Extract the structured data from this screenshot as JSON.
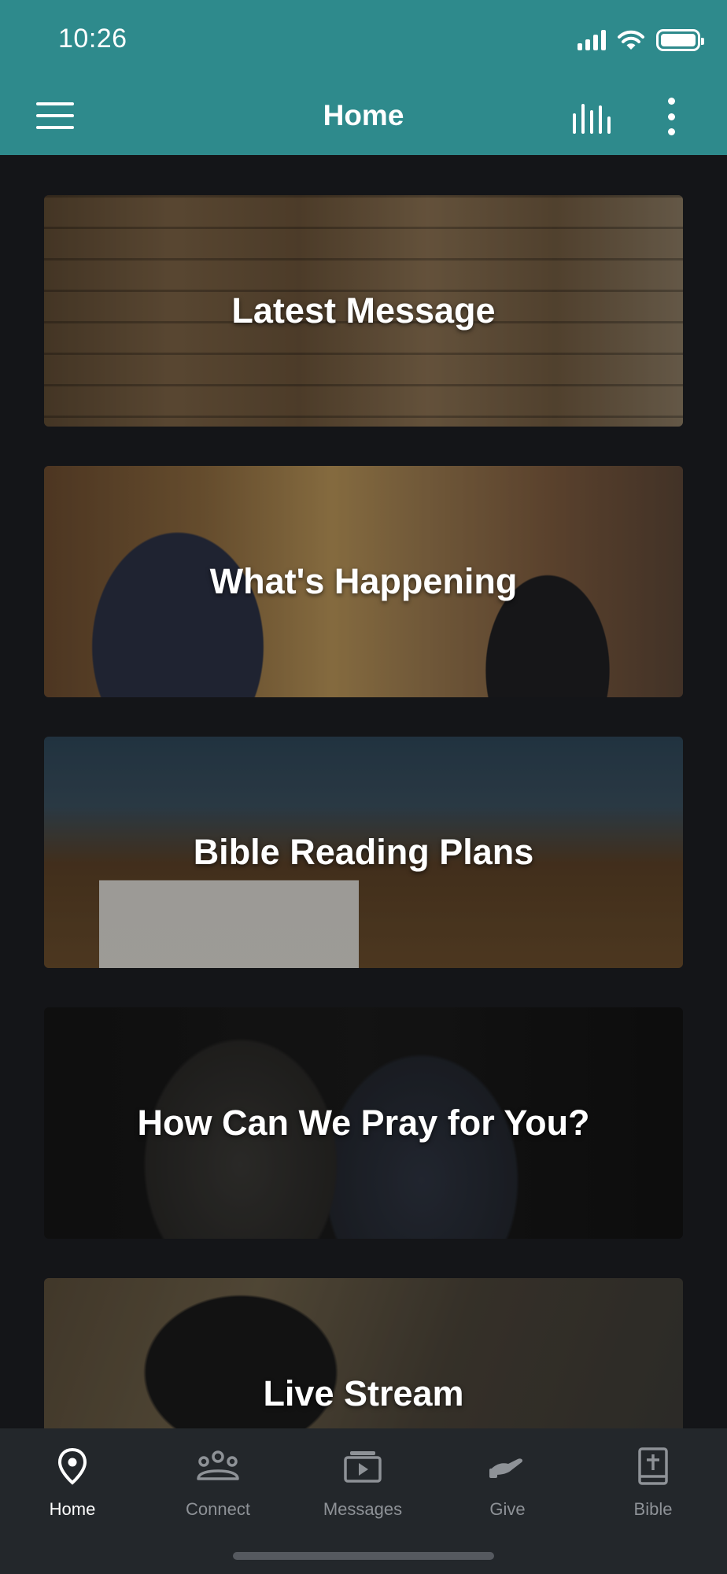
{
  "status_bar": {
    "time": "10:26"
  },
  "app_bar": {
    "title": "Home",
    "icons": [
      "hamburger-menu-icon",
      "equalizer-icon",
      "more-vertical-icon"
    ]
  },
  "cards": [
    {
      "title": "Latest Message"
    },
    {
      "title": "What's Happening"
    },
    {
      "title": "Bible Reading Plans"
    },
    {
      "title": "How Can We Pray for You?"
    },
    {
      "title": "Live Stream"
    }
  ],
  "tabs": [
    {
      "label": "Home",
      "icon": "location-pin-icon",
      "active": true
    },
    {
      "label": "Connect",
      "icon": "people-icon",
      "active": false
    },
    {
      "label": "Messages",
      "icon": "video-play-icon",
      "active": false
    },
    {
      "label": "Give",
      "icon": "giving-hand-icon",
      "active": false
    },
    {
      "label": "Bible",
      "icon": "bible-icon",
      "active": false
    }
  ],
  "colors": {
    "app_bar": "#2e8a8c",
    "background": "#141518",
    "tabbar": "#23272b",
    "tab_inactive": "#8e9297",
    "tab_active": "#ffffff"
  }
}
